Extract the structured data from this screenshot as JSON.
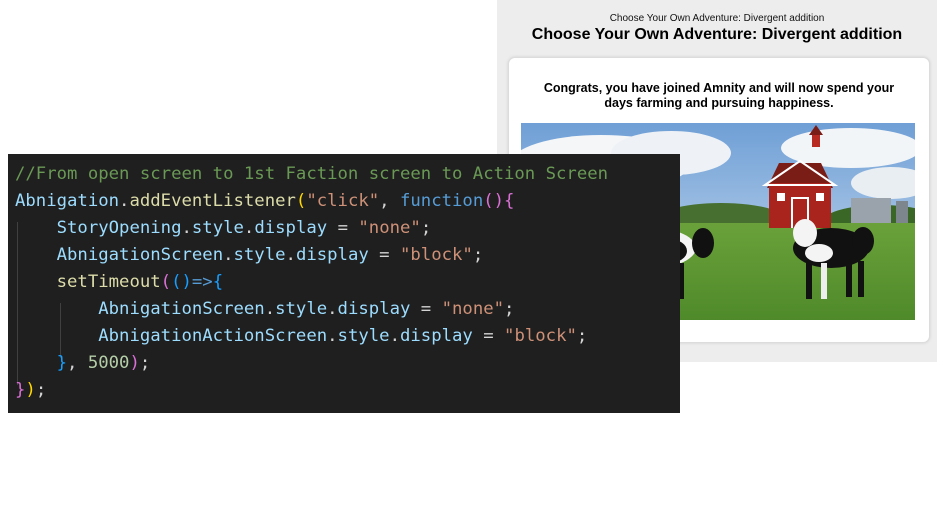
{
  "app": {
    "small_title": "Choose Your Own Adventure: Divergent addition",
    "main_title": "Choose Your Own Adventure: Divergent addition",
    "message": "Congrats, you have joined Amnity and will now spend your days farming and pursuing happiness.",
    "image_icon": "farm-cows-image"
  },
  "code": {
    "comment": "//From open screen to 1st Faction screen to Action Screen",
    "l2": {
      "obj": "Abnigation",
      "dot": ".",
      "method": "addEventListener",
      "open": "(",
      "str": "\"click\"",
      "comma": ", ",
      "kw": "function",
      "parens": "()",
      "brace": "{"
    },
    "l3": {
      "obj": "StoryOpening",
      "dot1": ".",
      "prop1": "style",
      "dot2": ".",
      "prop2": "display",
      "eq": " = ",
      "str": "\"none\"",
      "semi": ";"
    },
    "l4": {
      "obj": "AbnigationScreen",
      "dot1": ".",
      "prop1": "style",
      "dot2": ".",
      "prop2": "display",
      "eq": " = ",
      "str": "\"block\"",
      "semi": ";"
    },
    "l5": {
      "fn": "setTimeout",
      "open": "(",
      "args": "()",
      "arrow": "=>",
      "brace": "{"
    },
    "l6": {
      "obj": "AbnigationScreen",
      "dot1": ".",
      "prop1": "style",
      "dot2": ".",
      "prop2": "display",
      "eq": " = ",
      "str": "\"none\"",
      "semi": ";"
    },
    "l7": {
      "obj": "AbnigationActionScreen",
      "dot1": ".",
      "prop1": "style",
      "dot2": ".",
      "prop2": "display",
      "eq": " = ",
      "str": "\"block\"",
      "semi": ";"
    },
    "l8": {
      "brace": "}",
      "comma": ", ",
      "num": "5000",
      "close": ")",
      "semi": ";"
    },
    "l9": {
      "brace": "}",
      "close": ")",
      "semi": ";"
    }
  }
}
